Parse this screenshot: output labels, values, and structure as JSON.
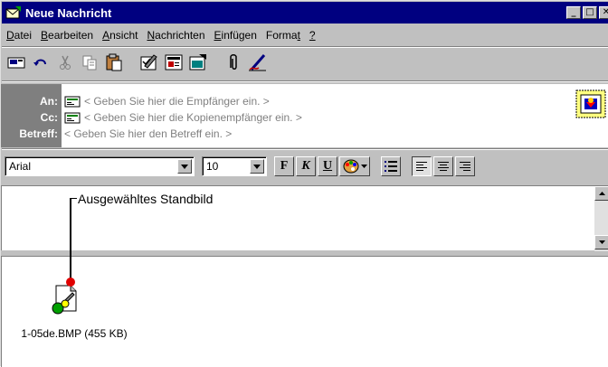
{
  "window": {
    "title": "Neue Nachricht"
  },
  "menu": [
    {
      "key": "D",
      "rest": "atei"
    },
    {
      "key": "B",
      "rest": "earbeiten"
    },
    {
      "key": "A",
      "rest": "nsicht"
    },
    {
      "key": "N",
      "rest": "achrichten"
    },
    {
      "key": "E",
      "rest": "infügen"
    },
    {
      "pre": "Forma",
      "key": "t",
      "rest": ""
    },
    {
      "key": "?",
      "rest": ""
    }
  ],
  "headers": {
    "to": {
      "label": "An:",
      "placeholder": "< Geben Sie hier die Empfänger ein. >"
    },
    "cc": {
      "label": "Cc:",
      "placeholder": "< Geben Sie hier die Kopienempfänger ein. >"
    },
    "subject": {
      "label": "Betreff:",
      "placeholder": "< Geben Sie hier den Betreff ein. >"
    }
  },
  "format": {
    "font": "Arial",
    "size": "10",
    "bold": "F",
    "italic": "K",
    "underline": "U"
  },
  "annotation": {
    "label": "Ausgewähltes Standbild"
  },
  "attachment": {
    "name": "1-05de.BMP (455 KB)"
  },
  "icons": {
    "toolbar": [
      "send-icon",
      "undo-icon",
      "cut-icon",
      "copy-icon",
      "paste-icon",
      "check-names-icon",
      "select-recipients-icon",
      "insert-file-icon",
      "attach-icon",
      "signature-icon"
    ],
    "format": [
      "color-icon",
      "bullet-list-icon",
      "align-left-icon",
      "align-center-icon",
      "align-right-icon"
    ]
  }
}
